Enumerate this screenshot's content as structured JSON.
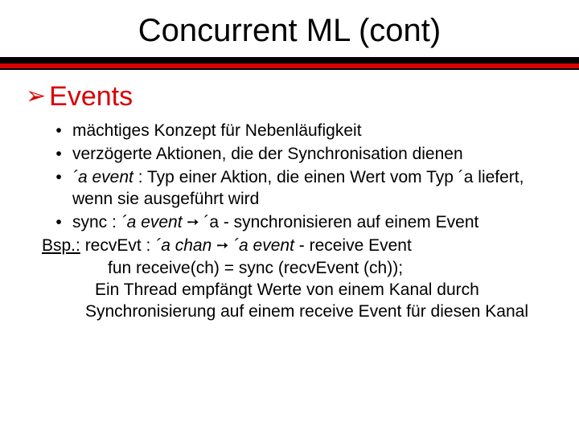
{
  "title": "Concurrent ML (cont)",
  "heading": "Events",
  "bullets": {
    "b1": "mächtiges Konzept für Nebenläufigkeit",
    "b2": "verzögerte Aktionen, die der Synchronisation dienen",
    "b3_pre": "´a event",
    "b3_post": " : Typ einer Aktion, die einen Wert vom Typ ´a liefert, wenn sie ausgeführt wird",
    "b4_pre": "sync : ",
    "b4_it": "´a event ",
    "b4_arrow": "➙",
    "b4_post": " ´a - synchronisieren auf einem Event"
  },
  "bsp": {
    "label": "Bsp.:",
    "l0_a": " recvEvt : ",
    "l0_it1": "´a chan ",
    "l0_arrow": "➙",
    "l0_it2": " ´a event",
    "l0_tail": "  -  receive Event",
    "l1": "fun receive(ch) = sync (recvEvent (ch));",
    "l2": "Ein Thread empfängt Werte von einem Kanal durch",
    "l3": "Synchronisierung auf einem receive Event für diesen Kanal"
  }
}
